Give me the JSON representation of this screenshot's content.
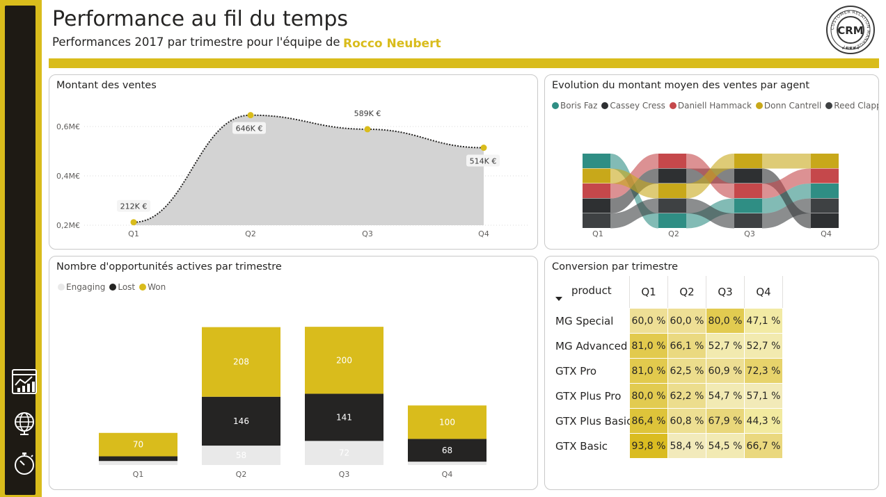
{
  "header": {
    "title": "Performance au fil du temps",
    "subtitle": "Performances 2017 par trimestre pour l'équipe de",
    "team": "Rocco Neubert",
    "logo_text": "CRM",
    "logo_ring_text": "CUSTOMER RELATION MANAGEMENT"
  },
  "nav": {
    "items": [
      {
        "icon": "dashboard-chart-icon"
      },
      {
        "icon": "globe-icon"
      },
      {
        "icon": "stopwatch-icon"
      }
    ]
  },
  "colors": {
    "accent": "#d9bc1c",
    "dark": "#252423",
    "light_gray": "#e9e9e9",
    "area_fill": "#d3d3d3"
  },
  "sales_chart": {
    "title": "Montant des ventes",
    "chart_data": {
      "type": "area",
      "categories": [
        "Q1",
        "Q2",
        "Q3",
        "Q4"
      ],
      "values": [
        212,
        646,
        589,
        514
      ],
      "data_labels": [
        "212K €",
        "646K €",
        "589K €",
        "514K €"
      ],
      "y_ticks": [
        "0,2M€",
        "0,4M€",
        "0,6M€"
      ],
      "y_tick_values": [
        200,
        400,
        600
      ],
      "ylim": [
        200,
        650
      ],
      "grid": true
    }
  },
  "ribbon_chart": {
    "title": "Evolution du montant moyen des ventes par agent",
    "chart_data": {
      "type": "ribbon",
      "categories": [
        "Q1",
        "Q2",
        "Q3",
        "Q4"
      ],
      "series": [
        {
          "name": "Boris Faz",
          "color": "#2f8e84",
          "rank": [
            1,
            5,
            4,
            3
          ]
        },
        {
          "name": "Cassey Cress",
          "color": "#2e3032",
          "rank": [
            4,
            2,
            2,
            5
          ]
        },
        {
          "name": "Daniell Hammack",
          "color": "#c5484b",
          "rank": [
            3,
            1,
            3,
            2
          ]
        },
        {
          "name": "Donn Cantrell",
          "color": "#c8a81a",
          "rank": [
            2,
            3,
            1,
            1
          ]
        },
        {
          "name": "Reed Clapper",
          "color": "#3e4143",
          "rank": [
            5,
            4,
            5,
            4
          ]
        }
      ]
    }
  },
  "opps_chart": {
    "title": "Nombre d'opportunités actives par trimestre",
    "chart_data": {
      "type": "bar",
      "stacked": true,
      "categories": [
        "Q1",
        "Q2",
        "Q3",
        "Q4"
      ],
      "series": [
        {
          "name": "Engaging",
          "color": "#e9e9e9",
          "values": [
            12,
            58,
            72,
            10
          ],
          "labels": [
            "",
            "58",
            "72",
            ""
          ]
        },
        {
          "name": "Lost",
          "color": "#252423",
          "values": [
            14,
            146,
            141,
            68
          ],
          "labels": [
            "",
            "146",
            "141",
            "68"
          ]
        },
        {
          "name": "Won",
          "color": "#d9bc1c",
          "values": [
            70,
            208,
            200,
            100
          ],
          "labels": [
            "70",
            "208",
            "200",
            "100"
          ]
        }
      ],
      "ylim": [
        0,
        420
      ]
    }
  },
  "conversion": {
    "title": "Conversion par trimestre",
    "row_header": "product",
    "columns": [
      "Q1",
      "Q2",
      "Q3",
      "Q4"
    ],
    "rows": [
      {
        "label": "MG Special",
        "values": [
          60.0,
          60.0,
          80.0,
          47.1
        ],
        "text": [
          "60,0 %",
          "60,0 %",
          "80,0 %",
          "47,1 %"
        ]
      },
      {
        "label": "MG Advanced",
        "values": [
          81.0,
          66.1,
          52.7,
          52.7
        ],
        "text": [
          "81,0 %",
          "66,1 %",
          "52,7 %",
          "52,7 %"
        ]
      },
      {
        "label": "GTX Pro",
        "values": [
          81.0,
          62.5,
          60.9,
          72.3
        ],
        "text": [
          "81,0 %",
          "62,5 %",
          "60,9 %",
          "72,3 %"
        ]
      },
      {
        "label": "GTX Plus Pro",
        "values": [
          80.0,
          62.2,
          54.7,
          57.1
        ],
        "text": [
          "80,0 %",
          "62,2 %",
          "54,7 %",
          "57,1 %"
        ]
      },
      {
        "label": "GTX Plus Basic",
        "values": [
          86.4,
          60.8,
          67.9,
          44.3
        ],
        "text": [
          "86,4 %",
          "60,8 %",
          "67,9 %",
          "44,3 %"
        ]
      },
      {
        "label": "GTX Basic",
        "values": [
          93.8,
          58.4,
          54.5,
          66.7
        ],
        "text": [
          "93,8 %",
          "58,4 %",
          "54,5 %",
          "66,7 %"
        ]
      }
    ]
  }
}
